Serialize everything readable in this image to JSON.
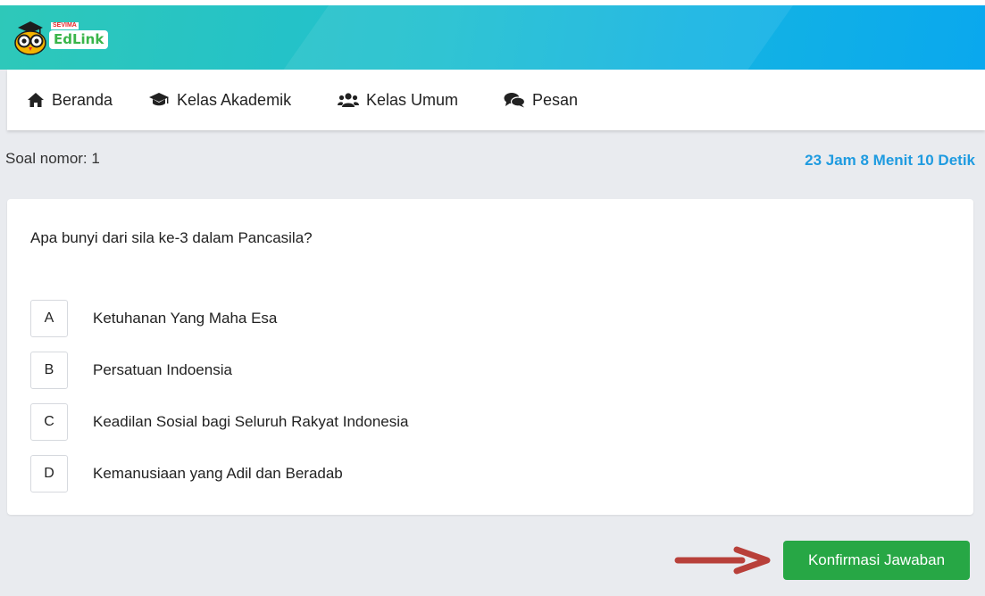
{
  "header": {
    "logo_tag": "SEVIMA",
    "logo_text": "EdLink"
  },
  "nav": {
    "items": [
      {
        "label": "Beranda",
        "icon": "home-icon"
      },
      {
        "label": "Kelas Akademik",
        "icon": "graduation-cap-icon"
      },
      {
        "label": "Kelas Umum",
        "icon": "users-icon"
      },
      {
        "label": "Pesan",
        "icon": "comments-icon"
      }
    ]
  },
  "quiz": {
    "soal_label": "Soal nomor: 1",
    "timer": "23 Jam 8 Menit 10 Detik",
    "question": "Apa bunyi dari sila ke-3 dalam Pancasila?",
    "options": [
      {
        "key": "A",
        "text": "Ketuhanan Yang Maha Esa"
      },
      {
        "key": "B",
        "text": "Persatuan Indoensia"
      },
      {
        "key": "C",
        "text": "Keadilan Sosial bagi Seluruh Rakyat Indonesia"
      },
      {
        "key": "D",
        "text": "Kemanusiaan yang Adil dan Beradab"
      }
    ],
    "confirm_label": "Konfirmasi Jawaban"
  },
  "colors": {
    "header_gradient_start": "#2ec8b9",
    "header_gradient_end": "#0aa8ee",
    "timer": "#1f9be0",
    "confirm_button": "#27a745",
    "annotation_arrow": "#c0392b"
  },
  "annotation": {
    "icon": "red-arrow-icon"
  }
}
